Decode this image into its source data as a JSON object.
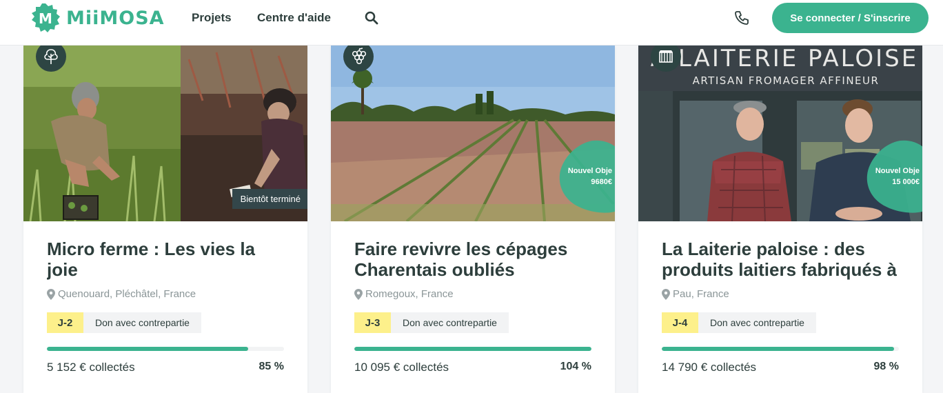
{
  "header": {
    "brand": "MiiMOSA",
    "nav": [
      {
        "label": "Projets"
      },
      {
        "label": "Centre d'aide"
      }
    ],
    "login_label": "Se connecter / S'inscrire"
  },
  "cards": [
    {
      "title": "Micro ferme : Les vies la joie",
      "location": "Quenouard, Pléchâtel, France",
      "days": "J-2",
      "type": "Don avec contrepartie",
      "collected": "5 152 € collectés",
      "percent": "85 %",
      "progress": 0.85,
      "status": "Bientôt terminé",
      "category_icon": "tree-icon"
    },
    {
      "title": "Faire revivre les cépages Charentais oubliés",
      "location": "Romegoux, France",
      "days": "J-3",
      "type": "Don avec contrepartie",
      "collected": "10 095 € collectés",
      "percent": "104 %",
      "progress": 1.0,
      "objective_label": "Nouvel Obje",
      "objective_value": "9680€",
      "category_icon": "grapes-icon"
    },
    {
      "title": "La Laiterie paloise : des produits laitiers fabriqués à",
      "location": "Pau, France",
      "days": "J-4",
      "type": "Don avec contrepartie",
      "collected": "14 790 € collectés",
      "percent": "98 %",
      "progress": 0.98,
      "objective_label": "Nouvel Obje",
      "objective_value": "15 000€",
      "shop_sign_line1": "A LAITERIE PALOISE",
      "shop_sign_line2": "ARTISAN FROMAGER AFFINEUR",
      "category_icon": "shop-icon"
    }
  ],
  "colors": {
    "brand_green": "#3bb38f",
    "text_dark": "#2d3e3c",
    "days_yellow": "#fdf08b",
    "badge_dark": "#2d4543"
  }
}
